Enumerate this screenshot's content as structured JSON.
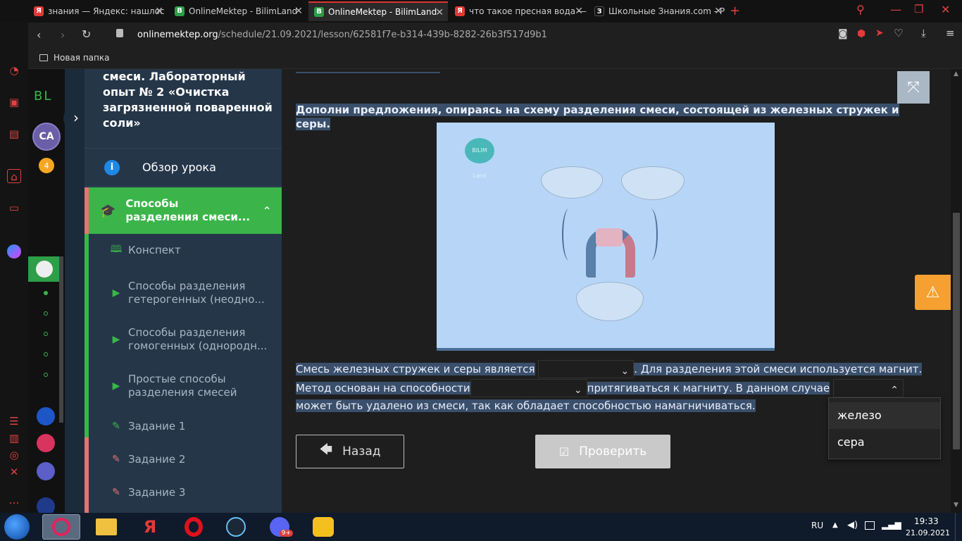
{
  "tabs": [
    {
      "label": "знания — Яндекс: нашлос",
      "icon": "yandex-icon",
      "color": "#e53935",
      "glyph": "Я"
    },
    {
      "label": "OnlineMektep - BilimLand",
      "icon": "bilimland-icon",
      "color": "#2e9e47",
      "glyph": "B"
    },
    {
      "label": "OnlineMektep - BilimLand",
      "icon": "bilimland-icon",
      "color": "#2e9e47",
      "glyph": "B"
    },
    {
      "label": "что такое пресная вода —",
      "icon": "yandex-icon",
      "color": "#e53935",
      "glyph": "Я"
    },
    {
      "label": "Школьные Знания.com - Р",
      "icon": "znania-icon",
      "color": "#111111",
      "glyph": "З"
    }
  ],
  "address": {
    "host": "onlinemektep.org",
    "path": "/schedule/21.09.2021/lesson/62581f7e-b314-439b-8282-26b3f517d9b1"
  },
  "bookmarks": [
    {
      "label": "Новая папка"
    }
  ],
  "app_sidebar": {
    "logo": "BL",
    "avatar": "CA",
    "badge": "4"
  },
  "lesson": {
    "title": "смеси. Лабораторный опыт № 2 «Очистка загрязненной поваренной соли»",
    "overview": "Обзор урока",
    "section": "Способы разделения смеси...",
    "items": [
      {
        "label": "Конспект",
        "icon": "book-icon"
      },
      {
        "label": "Способы разделения гетерогенных (неодно...",
        "icon": "play-icon"
      },
      {
        "label": "Способы разделения гомогенных (однородн...",
        "icon": "play-icon"
      },
      {
        "label": "Простые способы разделения смесей",
        "icon": "play-icon"
      },
      {
        "label": "Задание 1",
        "icon": "edit-icon"
      },
      {
        "label": "Задание 2",
        "icon": "edit-icon"
      },
      {
        "label": "Задание 3",
        "icon": "edit-icon"
      }
    ]
  },
  "task": {
    "prompt": "Дополни предложения, опираясь на схему разделения смеси, состоящей из железных стружек и серы.",
    "image_logo": "BILIM Land",
    "s1": "Смесь железных стружек и серы является",
    "s2": ". Для разделения этой смеси используется магнит.",
    "s3": "Метод основан на способности",
    "s4": "притягиваться к магниту. В данном случае",
    "s5": " может быть удалено из смеси, так как обладает способностью намагничиваться.",
    "options": [
      "железо",
      "сера"
    ],
    "back": "Назад",
    "check": "Проверить"
  },
  "taskbar": {
    "lang": "RU",
    "time": "19:33",
    "date": "21.09.2021",
    "discord_badge": "9+"
  },
  "colors": {
    "green": "#3bb54a",
    "highlight": "#3a4f6b",
    "warning": "#f5a030",
    "red": "#e57373"
  }
}
